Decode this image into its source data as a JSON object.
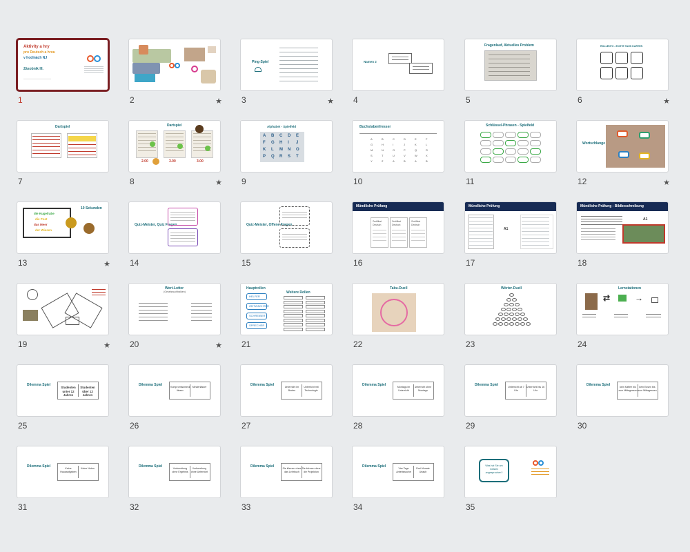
{
  "slides": [
    {
      "n": "1",
      "star": false,
      "selected": true,
      "title": "Aktivity a hry",
      "line2": "pro Deutsch a hrou",
      "line3": "v hodinách NJ",
      "line4": "Zásobník III."
    },
    {
      "n": "2",
      "star": true
    },
    {
      "n": "3",
      "star": true,
      "title": "Ping-Spiel"
    },
    {
      "n": "4",
      "star": false,
      "title": "Namen 2"
    },
    {
      "n": "5",
      "star": false,
      "title": "Fragenlauf, Aktuelles Problem"
    },
    {
      "n": "6",
      "star": true,
      "title": "ROLLENTX - ECHTE TAUS KARTEN"
    },
    {
      "n": "7",
      "star": false,
      "title": "Dartspiel"
    },
    {
      "n": "8",
      "star": true,
      "title": "Dartspiel",
      "scores": [
        "2.00",
        "3.00",
        "3.00"
      ]
    },
    {
      "n": "9",
      "star": false,
      "title": "Alphabet - Spielfeld"
    },
    {
      "n": "10",
      "star": false,
      "title": "Buchstabenfresser"
    },
    {
      "n": "11",
      "star": false,
      "title": "Schlüssel-Phrasen - Spielfeld"
    },
    {
      "n": "12",
      "star": true,
      "title": "Wortschlange"
    },
    {
      "n": "13",
      "star": true,
      "title": "10 Sekunden",
      "words": [
        "die Kugelrabe",
        "die Post",
        "das Meer",
        "der Wiesen"
      ]
    },
    {
      "n": "14",
      "star": false,
      "title": "Quiz-Meister, Quiz Fragen"
    },
    {
      "n": "15",
      "star": false,
      "title": "Quiz-Meister, Offene Fragen"
    },
    {
      "n": "16",
      "star": false,
      "title": "Mündliche Prüfung",
      "cards": [
        "Zertifikat Deutsch",
        "Zertifikat Deutsch",
        "Zertifikat Deutsch"
      ]
    },
    {
      "n": "17",
      "star": false,
      "title": "Mündliche Prüfung",
      "level": "A1"
    },
    {
      "n": "18",
      "star": false,
      "title": "Mündliche Prüfung - Bildbeschreibung",
      "level": "A1"
    },
    {
      "n": "19",
      "star": true
    },
    {
      "n": "20",
      "star": true,
      "title": "Wort-Lotter",
      "subtitle": "(Gesetzsuchbalken)"
    },
    {
      "n": "21",
      "star": false,
      "title": "Hauptrollen",
      "title2": "Weitere Rollen",
      "roles": [
        "HELFER",
        "ZEITWÄCHTER",
        "SCHREIBER",
        "SPRECHER"
      ]
    },
    {
      "n": "22",
      "star": false,
      "title": "Tabu-Duell"
    },
    {
      "n": "23",
      "star": false,
      "title": "Wörter-Duell"
    },
    {
      "n": "24",
      "star": false,
      "title": "Lernstationen"
    },
    {
      "n": "25",
      "star": false,
      "title": "Dilemma Spiel",
      "left": "Studenten unter 12 Jahren",
      "right": "Studenten über 12 Jahren",
      "big": true
    },
    {
      "n": "26",
      "star": false,
      "title": "Dilemma Spiel",
      "left": "Kompromissmeck lässer",
      "right": "Minderlässer"
    },
    {
      "n": "27",
      "star": false,
      "title": "Dilemma Spiel",
      "left": "Unterricht im Broten",
      "right": "Unterricht mit Technologie"
    },
    {
      "n": "28",
      "star": false,
      "title": "Dilemma Spiel",
      "left": "Montags im Unterricht",
      "right": "Unterricht ohne Montags"
    },
    {
      "n": "29",
      "star": false,
      "title": "Dilemma Spiel",
      "left": "Unterricht ab 7 Uhr",
      "right": "Unterricht bis 16 Uhr"
    },
    {
      "n": "30",
      "star": false,
      "title": "Dilemma Spiel",
      "left": "kein Kaffee bis zum Mittagessen",
      "right": "kein Essen bis zum Mittagessen"
    },
    {
      "n": "31",
      "star": false,
      "title": "Dilemma Spiel",
      "left": "Keine Hausaufgaben",
      "right": "Keine Noten"
    },
    {
      "n": "32",
      "star": false,
      "title": "Dilemma Spiel",
      "left": "Vorbereitung ohne Ergebnis",
      "right": "Vorbereitung ohne Unterricht"
    },
    {
      "n": "33",
      "star": false,
      "title": "Dilemma Spiel",
      "left": "Sie können ohne das Lehrbuch",
      "right": "Sie können ohne die Projektion"
    },
    {
      "n": "34",
      "star": false,
      "title": "Dilemma Spiel",
      "left": "Vier Tage Arbeitswoche",
      "right": "Drei Monate Urlaub"
    },
    {
      "n": "35",
      "star": false,
      "title": "Was hat Sie am meisten angesprochen?"
    }
  ],
  "colors": {
    "accent": "#1c6e7a",
    "selected_border": "#7a1e22",
    "navy": "#172b54"
  }
}
